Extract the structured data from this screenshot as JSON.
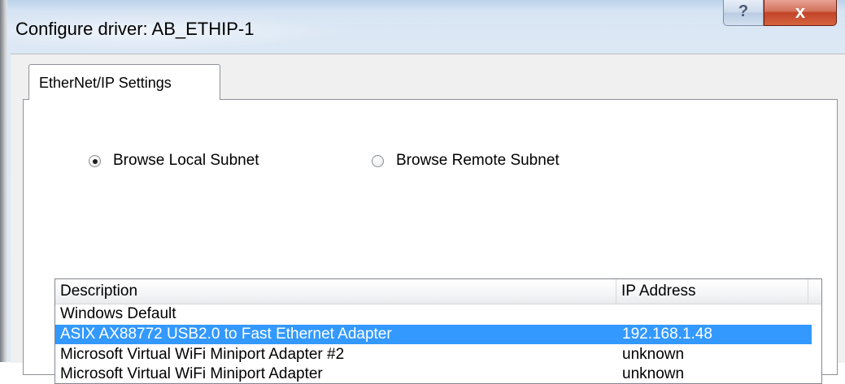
{
  "window": {
    "title": "Configure driver: AB_ETHIP-1",
    "help_glyph": "?",
    "close_glyph": "x"
  },
  "tabs": [
    {
      "label": "EtherNet/IP Settings",
      "selected": true
    }
  ],
  "browse_options": [
    {
      "label": "Browse Local Subnet",
      "checked": true
    },
    {
      "label": "Browse Remote Subnet",
      "checked": false
    }
  ],
  "adapter_list": {
    "columns": [
      "Description",
      "IP Address"
    ],
    "rows": [
      {
        "description": "Windows Default",
        "ip": "",
        "selected": false
      },
      {
        "description": "ASIX AX88772 USB2.0 to Fast Ethernet Adapter",
        "ip": "192.168.1.48",
        "selected": true
      },
      {
        "description": "Microsoft Virtual WiFi Miniport Adapter #2",
        "ip": "unknown",
        "selected": false
      },
      {
        "description": "Microsoft Virtual WiFi Miniport Adapter",
        "ip": "unknown",
        "selected": false
      }
    ]
  },
  "colors": {
    "selection": "#3399ff",
    "close_button": "#c24428"
  }
}
